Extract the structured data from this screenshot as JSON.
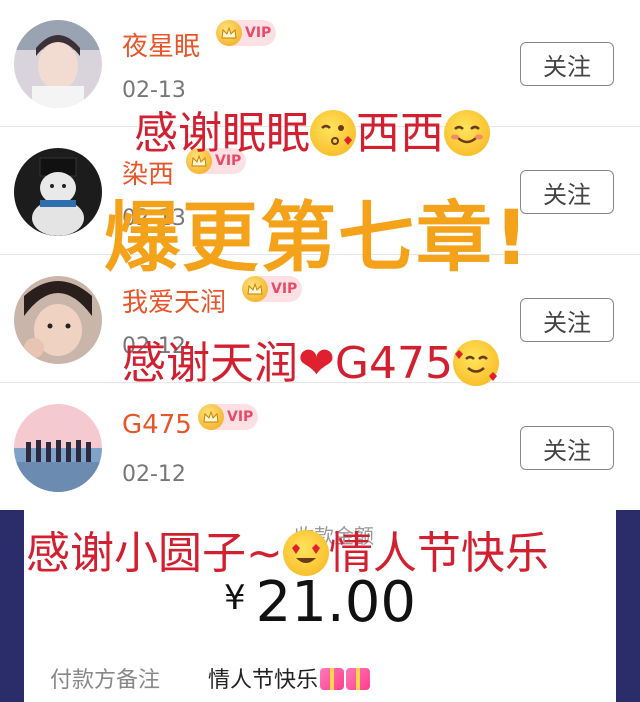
{
  "list": {
    "follow_label": "关注",
    "vip_label": "VIP",
    "rows": [
      {
        "name": "夜星眠",
        "date": "02-13"
      },
      {
        "name": "染西",
        "date": "02-13"
      },
      {
        "name": "我爱天润",
        "date": "02-12"
      },
      {
        "name": "G475",
        "date": "02-12"
      }
    ]
  },
  "overlays": {
    "line1_a": "感谢眠眠",
    "line1_b": "西西",
    "line2": "爆更第七章!",
    "line3_a": "感谢天润",
    "line3_b": "G475",
    "line4_a": "感谢小圆子~",
    "line4_b": "情人节快乐"
  },
  "payment": {
    "amount_label": "收款金额",
    "currency": "¥",
    "amount": "21.00",
    "remark_label": "付款方备注",
    "remark_value": "情人节快乐"
  },
  "colors": {
    "name": "#e8552a",
    "overlay_red": "#d32031",
    "overlay_orange": "#f5a21b",
    "payment_bg": "#2b2c6a"
  }
}
